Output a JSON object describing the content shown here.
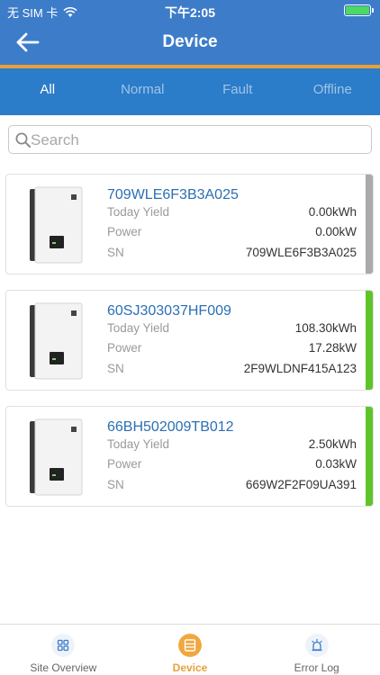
{
  "status_bar": {
    "carrier": "无 SIM 卡",
    "time": "下午2:05"
  },
  "header": {
    "title": "Device"
  },
  "tabs": [
    {
      "label": "All",
      "active": true
    },
    {
      "label": "Normal",
      "active": false
    },
    {
      "label": "Fault",
      "active": false
    },
    {
      "label": "Offline",
      "active": false
    }
  ],
  "search": {
    "placeholder": "Search",
    "value": ""
  },
  "devices": [
    {
      "id": "709WLE6F3B3A025",
      "today_yield_label": "Today Yield",
      "today_yield": "0.00kWh",
      "power_label": "Power",
      "power": "0.00kW",
      "sn_label": "SN",
      "sn": "709WLE6F3B3A025",
      "status_color": "#aaaaaa"
    },
    {
      "id": "60SJ303037HF009",
      "today_yield_label": "Today Yield",
      "today_yield": "108.30kWh",
      "power_label": "Power",
      "power": "17.28kW",
      "sn_label": "SN",
      "sn": "2F9WLDNF415A123",
      "status_color": "#5fc42a"
    },
    {
      "id": "66BH502009TB012",
      "today_yield_label": "Today Yield",
      "today_yield": "2.50kWh",
      "power_label": "Power",
      "power": "0.03kW",
      "sn_label": "SN",
      "sn": "669W2F2F09UA391",
      "status_color": "#5fc42a"
    }
  ],
  "bottom_nav": [
    {
      "label": "Site Overview",
      "icon": "grid-icon",
      "active": false
    },
    {
      "label": "Device",
      "icon": "device-icon",
      "active": true
    },
    {
      "label": "Error Log",
      "icon": "alarm-icon",
      "active": false
    }
  ],
  "colors": {
    "header_blue": "#3d7cc9",
    "tab_blue": "#2b7cc9",
    "accent_orange": "#e8a13a",
    "online_green": "#5fc42a",
    "offline_gray": "#aaaaaa",
    "link_blue": "#2b6fb5"
  }
}
